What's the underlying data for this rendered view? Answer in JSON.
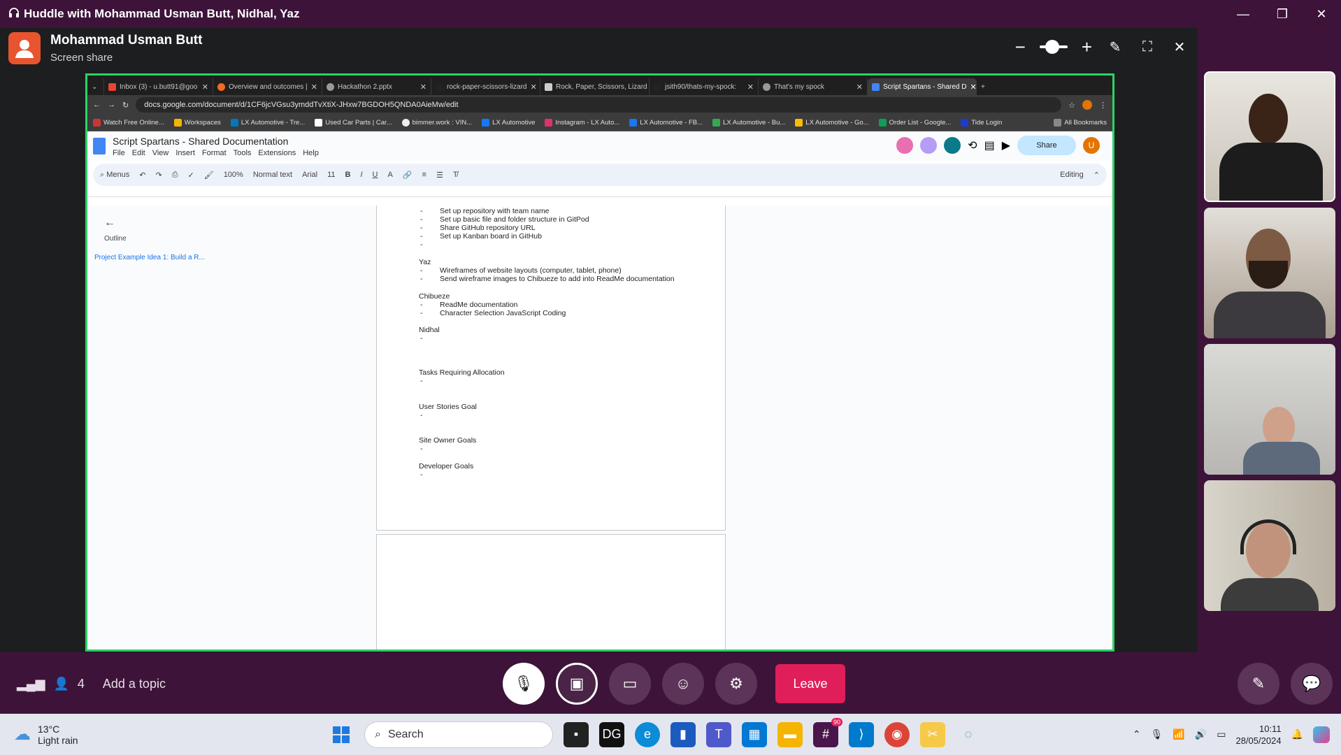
{
  "window": {
    "title": "Huddle with Mohammad Usman Butt, Nidhal, Yaz"
  },
  "presenter": {
    "name": "Mohammad Usman Butt",
    "status": "Screen share"
  },
  "browser": {
    "tabs": [
      "Inbox (3) - u.butt91@goo",
      "Overview and outcomes |",
      "Hackathon 2.pptx",
      "rock-paper-scissors-lizard",
      "Rock, Paper, Scissors, Lizard",
      "jsith90/thats-my-spock:",
      "That's my spock",
      "Script Spartans - Shared D"
    ],
    "url": "docs.google.com/document/d/1CF6jcVGsu3ymddTvXtiX-JHxw7BGDOH5QNDA0AieMw/edit",
    "bookmarks": [
      "Watch Free Online...",
      "Workspaces",
      "LX Automotive - Tre...",
      "Used Car Parts | Car...",
      "bimmer.work : VIN...",
      "LX Automotive",
      "Instagram - LX Auto...",
      "LX Automotive - FB...",
      "LX Automotive - Bu...",
      "LX Automotive - Go...",
      "Order List - Google...",
      "Tide Login"
    ],
    "all_bookmarks": "All Bookmarks"
  },
  "doc": {
    "title": "Script Spartans - Shared Documentation",
    "menu": [
      "File",
      "Edit",
      "View",
      "Insert",
      "Format",
      "Tools",
      "Extensions",
      "Help"
    ],
    "share": "Share",
    "user_initial": "U",
    "toolbar": {
      "menus": "Menus",
      "zoom": "100%",
      "style": "Normal text",
      "font": "Arial",
      "size": "11",
      "mode": "Editing"
    },
    "outline_label": "Outline",
    "outline_item": "Project Example Idea 1: Build a R...",
    "bullets_top": [
      "Set up repository with team name",
      "Set up basic file and folder structure in GitPod",
      "Share GitHub repository URL",
      "Set up Kanban board in GitHub",
      ""
    ],
    "yaz": "Yaz",
    "yaz_items": [
      "Wireframes of website layouts (computer, tablet, phone)",
      "Send wireframe images to Chibueze to add into ReadMe documentation"
    ],
    "chibueze": "Chibueze",
    "chibueze_items": [
      "ReadMe documentation",
      "Character Selection JavaScript Coding"
    ],
    "nidhal": "Nidhal",
    "tasks": "Tasks Requiring Allocation",
    "user_stories": "User Stories Goal",
    "site_owner": "Site Owner Goals",
    "developer": "Developer Goals",
    "dash": "-"
  },
  "bottom": {
    "participants": "4",
    "topic": "Add a topic",
    "leave": "Leave"
  },
  "taskbar": {
    "temp": "13°C",
    "weather": "Light rain",
    "search": "Search",
    "time": "10:11",
    "date": "28/05/2024",
    "badge": "90"
  },
  "colors": {
    "accent": "#2bd365",
    "leave": "#e01e5a",
    "purple": "#3d1339"
  }
}
